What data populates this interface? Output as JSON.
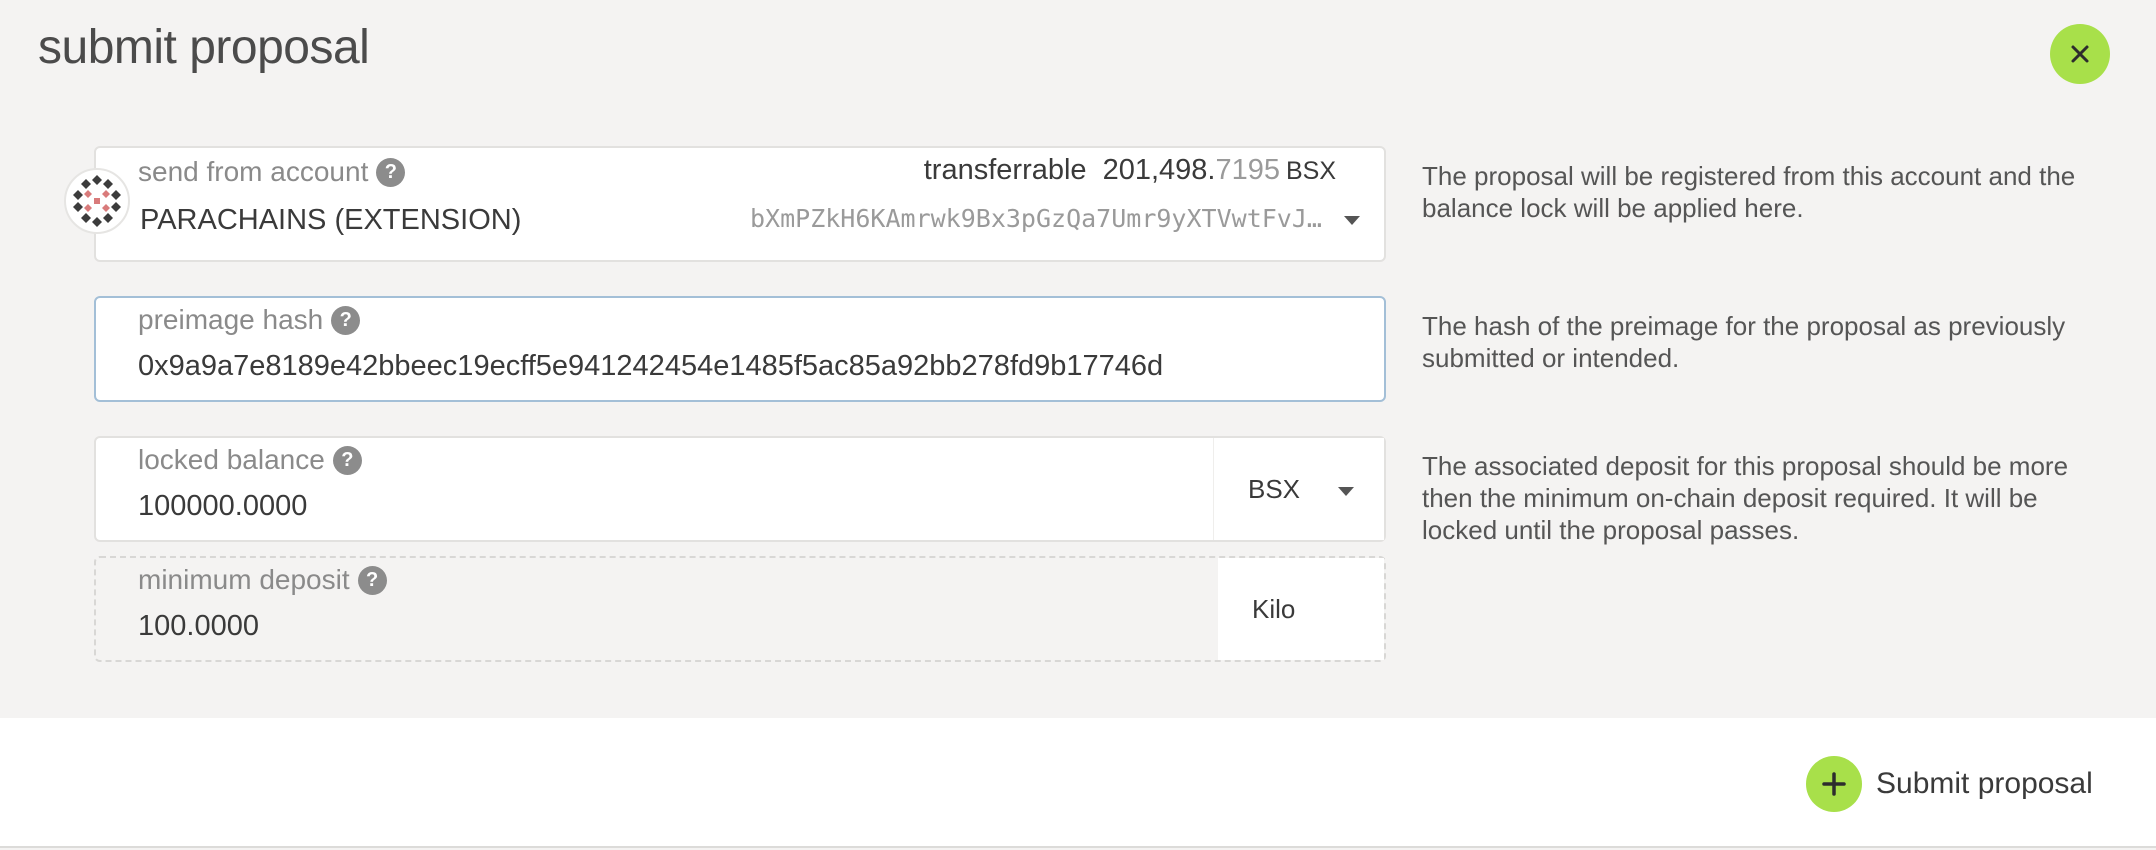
{
  "modal": {
    "title": "submit proposal",
    "close_label": "×"
  },
  "account": {
    "label": "send from account",
    "name": "PARACHAINS (EXTENSION)",
    "address": "bXmPZkH6KAmrwk9Bx3pGzQa7Umr9yXTVwtFvJ…",
    "transferrable_label": "transferrable",
    "balance_integer": "201,498.",
    "balance_decimal": "7195",
    "balance_unit": "BSX",
    "help_text": "The proposal will be registered from this account and the balance lock will be applied here."
  },
  "preimage": {
    "label": "preimage hash",
    "value": "0x9a9a7e8189e42bbeec19ecff5e941242454e1485f5ac85a92bb278fd9b17746d",
    "help_text": "The hash of the preimage for the proposal as previously submitted or intended."
  },
  "locked_balance": {
    "label": "locked balance",
    "value": "100000.0000",
    "unit": "BSX",
    "help_text": "The associated deposit for this proposal should be more then the minimum on-chain deposit required. It will be locked until the proposal passes."
  },
  "minimum_deposit": {
    "label": "minimum deposit",
    "value": "100.0000",
    "unit": "Kilo"
  },
  "footer": {
    "submit_label": "Submit proposal"
  },
  "colors": {
    "accent": "#a8e04a",
    "background": "#f4f3f2",
    "focus_border": "#a3bfd7"
  },
  "icons": {
    "close": "close-icon",
    "help": "question-mark-icon",
    "plus": "plus-icon",
    "caret": "chevron-down-icon",
    "avatar": "identicon-avatar"
  }
}
